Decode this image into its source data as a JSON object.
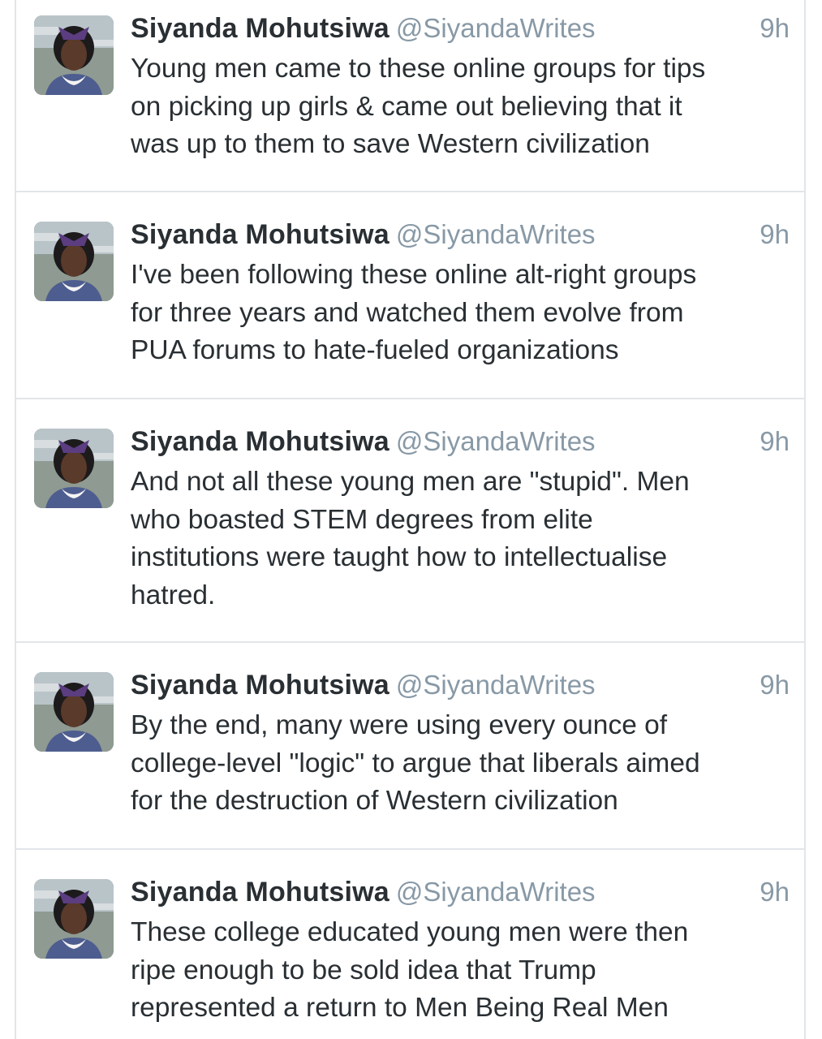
{
  "tweets": [
    {
      "name": "Siyanda Mohutsiwa",
      "handle": "@SiyandaWrites",
      "time": "9h",
      "lines": [
        "Young men came to these online groups for tips",
        "on picking up girls & came out believing that it",
        "was up to them to save Western civilization"
      ]
    },
    {
      "name": "Siyanda Mohutsiwa",
      "handle": "@SiyandaWrites",
      "time": "9h",
      "lines": [
        "I've been following these online alt-right groups",
        "for three years and watched them evolve from",
        "PUA forums to hate-fueled organizations"
      ]
    },
    {
      "name": "Siyanda Mohutsiwa",
      "handle": "@SiyandaWrites",
      "time": "9h",
      "lines": [
        "And not all these young men are \"stupid\". Men",
        "who boasted STEM degrees from elite",
        "institutions were taught how to intellectualise",
        "hatred."
      ]
    },
    {
      "name": "Siyanda Mohutsiwa",
      "handle": "@SiyandaWrites",
      "time": "9h",
      "lines": [
        "By the end, many were using every ounce of",
        "college-level \"logic\" to argue that liberals aimed",
        "for the destruction of Western civilization"
      ]
    },
    {
      "name": "Siyanda Mohutsiwa",
      "handle": "@SiyandaWrites",
      "time": "9h",
      "lines": [
        "These college educated young men were then",
        "ripe enough to be sold idea that Trump",
        "represented a return to Men Being Real Men"
      ]
    }
  ],
  "icons": {
    "avatar": "profile-photo"
  },
  "colors": {
    "name": "#292f33",
    "meta": "#8899a6",
    "divider": "#e1e6ea"
  }
}
